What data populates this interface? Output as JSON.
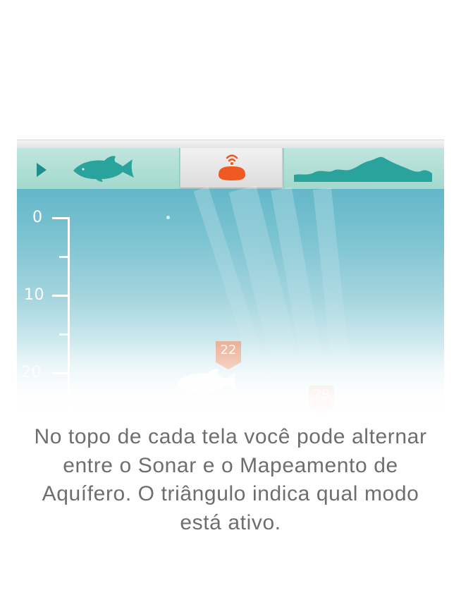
{
  "tabs": {
    "fish_tab": {
      "icon": "fish-icon",
      "indicator_icon": "play-triangle-icon",
      "active": true
    },
    "sonar_tab": {
      "icon": "sonar-device-icon"
    },
    "map_tab": {
      "icon": "depth-profile-icon"
    }
  },
  "depth_scale": {
    "labels": [
      "0",
      "10",
      "20"
    ]
  },
  "fish_markers": [
    {
      "depth_label": "22"
    },
    {
      "depth_label": "29"
    }
  ],
  "caption": "No topo de cada tela você pode alternar entre o Sonar e o Mapeamento de Aquífero. O triângulo indica qual modo está ativo.",
  "colors": {
    "tab_teal": "#a9ddd3",
    "fish_teal": "#2aa39d",
    "sonar_orange": "#ef5a22",
    "marker_orange": "#f2a07e",
    "water_top": "#63b7c9",
    "caption_gray": "#6e6e6e"
  }
}
